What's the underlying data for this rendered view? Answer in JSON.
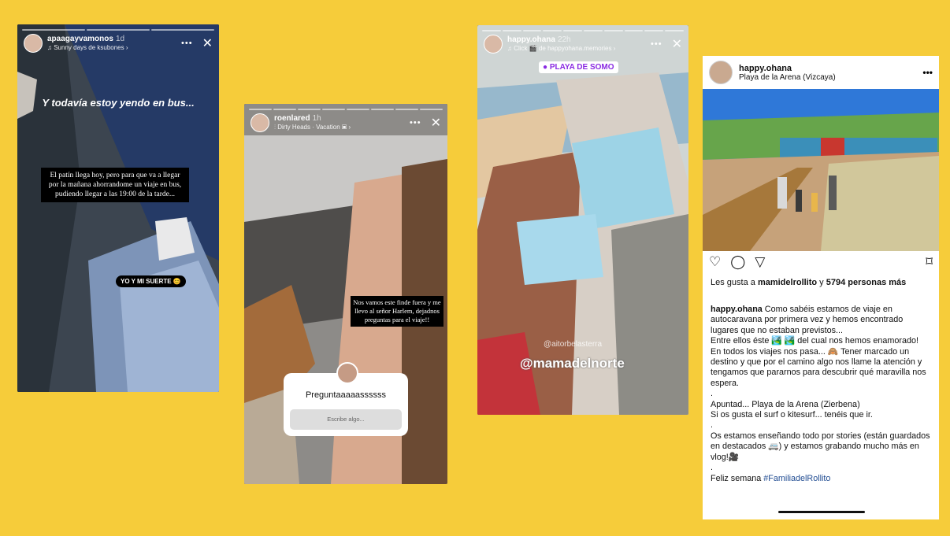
{
  "stories": [
    {
      "user": "apaagayvamonos",
      "time": "1d",
      "music": "♫ Sunny days de ksubones ›",
      "headline": "Y todavía estoy yendo en bus...",
      "body": "El patín llega hoy, pero para que va a llegar por la mañana ahorrandome un viaje en bus, pudiendo llegar a las 19:00 de la tarde...",
      "sticker": "YO Y MI SUERTE 😊"
    },
    {
      "user": "roenlared",
      "time": "1h",
      "music": "⫶ Dirty Heads · Vacation ▣ ›",
      "body": "Nos vamos este finde fuera y me llevo al señor Harlem, dejadnos preguntas para el viaje!!",
      "question_title": "Preguntaaaaassssss",
      "question_placeholder": "Escribe algo..."
    },
    {
      "user": "happy.ohana",
      "time": "22h",
      "music": "♫ Click 🎬 de happyohana.memories ›",
      "location": "PLAYA DE SOMO",
      "mention_small": "@aitorbelasterra",
      "mention": "@mamadelnorte"
    }
  ],
  "post": {
    "user": "happy.ohana",
    "location": "Playa de la Arena (Vizcaya)",
    "likes_prefix": "Les gusta a ",
    "likes_user": "mamidelrollito",
    "likes_mid": " y ",
    "likes_count": "5794 personas más",
    "caption_user": "happy.ohana",
    "caption_1": " Como sabéis estamos de viaje en autocaravana por primera vez y hemos encontrado lugares que no estaban previstos...",
    "caption_2": "Entre ellos éste 🏞️ 🏞️ del cual nos hemos enamorado!",
    "caption_3": "En todos los viajes nos pasa... 🙈 Tener marcado un destino y que por el camino algo nos llame la atención y tengamos que pararnos para descubrir qué maravilla nos espera.",
    "caption_4": "Apuntad... Playa de la Arena (Zierbena)",
    "caption_5": "Si os gusta el surf o kitesurf... tenéis que ir.",
    "caption_6": "Os estamos enseñando todo por stories (están guardados en destacados 🚐) y estamos grabando mucho más en vlog!🎥",
    "caption_7": "Feliz semana ",
    "hashtag": "#FamiliadelRollito"
  },
  "icons": [
    "heart-icon",
    "comment-icon",
    "share-icon",
    "bookmark-icon",
    "close-icon",
    "more-icon",
    "location-pin-icon"
  ],
  "colors": {
    "background": "#f6cc3a",
    "hashtag": "#234e93"
  }
}
